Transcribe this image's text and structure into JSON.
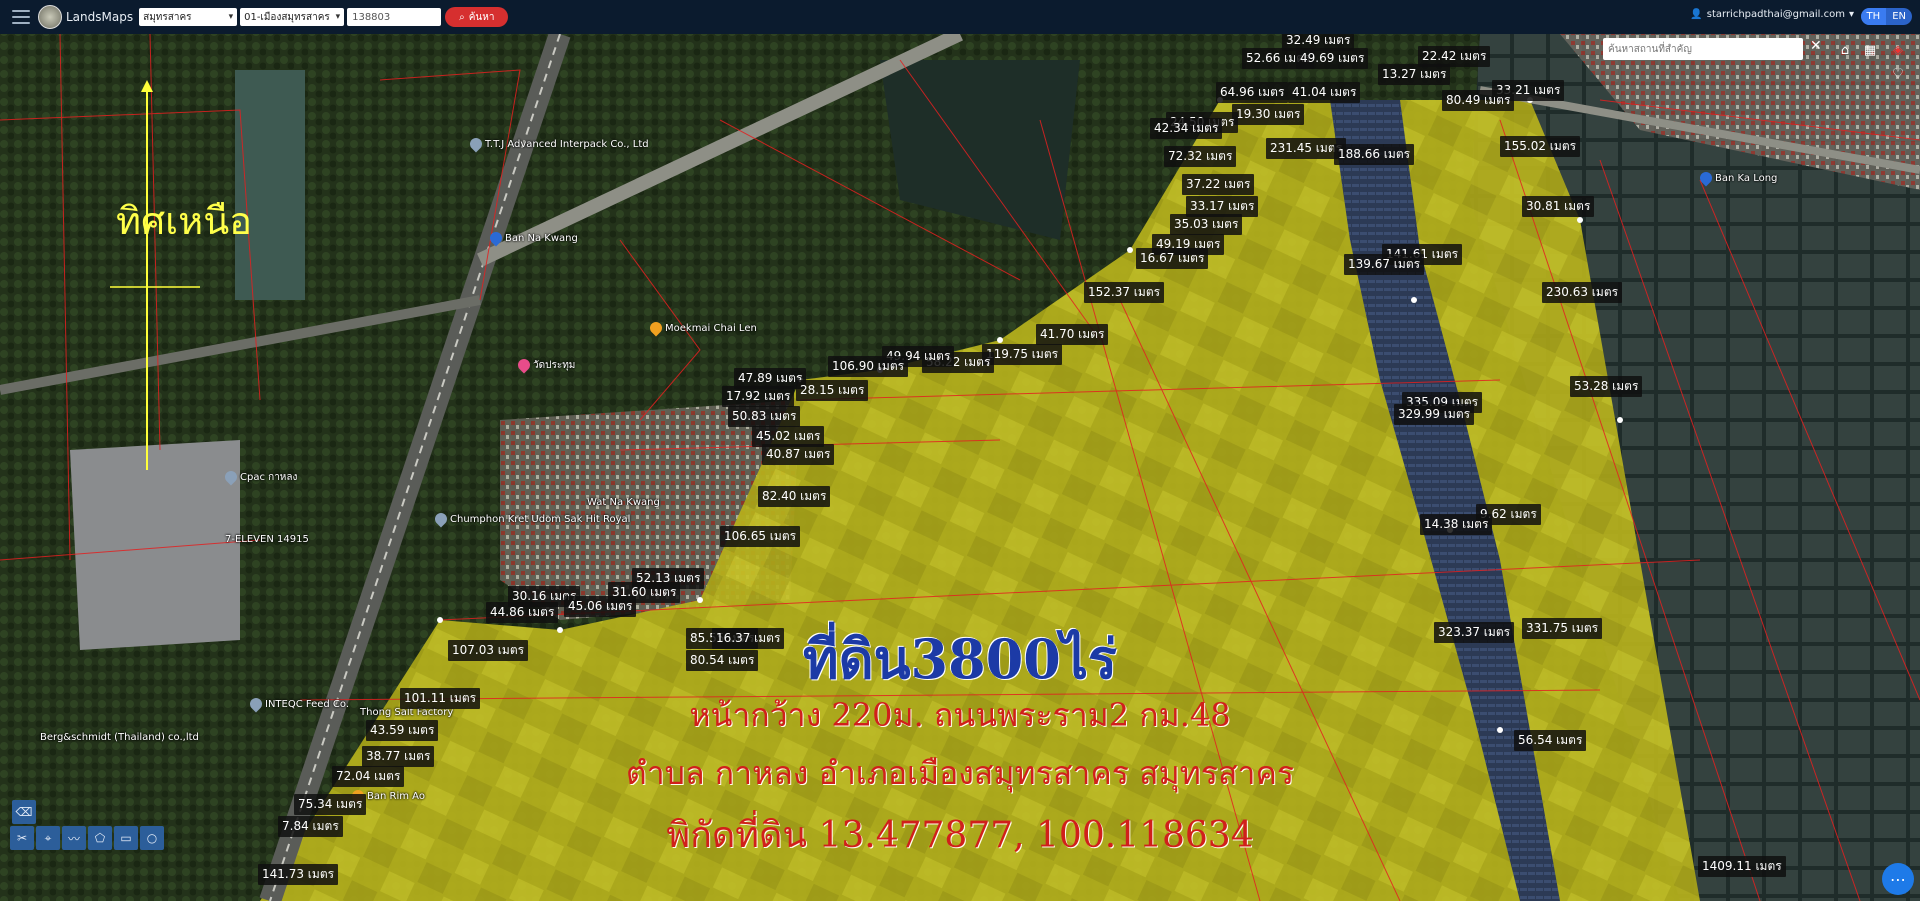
{
  "topbar": {
    "brand": "LandsMaps",
    "province": "สมุทรสาคร",
    "district": "01-เมืองสมุทรสาคร",
    "parcel_no": "138803",
    "search_label": "ค้นหา",
    "user_email": "starrichpadthai@gmail.com",
    "lang_th": "TH",
    "lang_en": "EN"
  },
  "map_tools": {
    "place_search_placeholder": "ค้นหาสถานที่สำคัญ"
  },
  "north_label": "ทิศเหนือ",
  "overlay": {
    "title": "ที่ดิน3800ไร่",
    "line1": "หน้ากว้าง 220ม. ถนนพระราม2 กม.48",
    "line2": "ตำบล กาหลง อำเภอเมืองสมุทรสาคร สมุทรสาคร",
    "line3": "พิกัดที่ดิน 13.477877, 100.118634"
  },
  "places": [
    {
      "name": "T.T.J Advanced Interpack Co., Ltd"
    },
    {
      "name": "Ban Na Kwang"
    },
    {
      "name": "Moekmai Chai Len"
    },
    {
      "name": "Wat Na Kwang"
    },
    {
      "name": "Chumphon Kret Udom Sak Hit Royal"
    },
    {
      "name": "7-ELEVEN 14915"
    },
    {
      "name": "Cpac กาหลง"
    },
    {
      "name": "INTEQC Feed Co."
    },
    {
      "name": "Thong Salt Factory"
    },
    {
      "name": "Ban Rim Ao"
    },
    {
      "name": "Berg&schmidt (Thailand) co.,ltd"
    },
    {
      "name": "Ban Ka Long"
    },
    {
      "name": "วัดประทุม"
    }
  ],
  "distances": [
    "52.66 เมตร",
    "49.69 เมตร",
    "32.49 เมตร",
    "22.42 เมตร",
    "13.27 เมตร",
    "41.04 เมตร",
    "33.21 เมตร",
    "64.96 เมตร",
    "80.49 เมตร",
    "19.30 เมตร",
    "24.50 เมตร",
    "42.34 เมตร",
    "231.45 เมตร",
    "188.66 เมตร",
    "155.02 เมตร",
    "72.32 เมตร",
    "37.22 เมตร",
    "33.17 เมตร",
    "35.03 เมตร",
    "30.81 เมตร",
    "49.19 เมตร",
    "16.67 เมตร",
    "141.61 เมตร",
    "139.67 เมตร",
    "152.37 เมตร",
    "230.63 เมตร",
    "41.70 เมตร",
    "119.75 เมตร",
    "58.22 เมตร",
    "49.94 เมตร",
    "106.90 เมตร",
    "47.89 เมตร",
    "28.15 เมตร",
    "17.92 เมตร",
    "53.28 เมตร",
    "335.09 เมตร",
    "329.99 เมตร",
    "50.83 เมตร",
    "45.02 เมตร",
    "40.87 เมตร",
    "82.40 เมตร",
    "9.62 เมตร",
    "14.38 เมตร",
    "106.65 เมตร",
    "52.13 เมตร",
    "31.60 เมตร",
    "30.16 เมตร",
    "44.86 เมตร",
    "45.06 เมตร",
    "85.55 เมตร",
    "16.37 เมตร",
    "331.75 เมตร",
    "323.37 เมตร",
    "107.03 เมตร",
    "80.54 เมตร",
    "101.11 เมตร",
    "43.59 เมตร",
    "38.77 เมตร",
    "72.04 เมตร",
    "56.54 เมตร",
    "75.34 เมตร",
    "7.84 เมตร",
    "141.73 เมตร",
    "1409.11 เมตร"
  ]
}
